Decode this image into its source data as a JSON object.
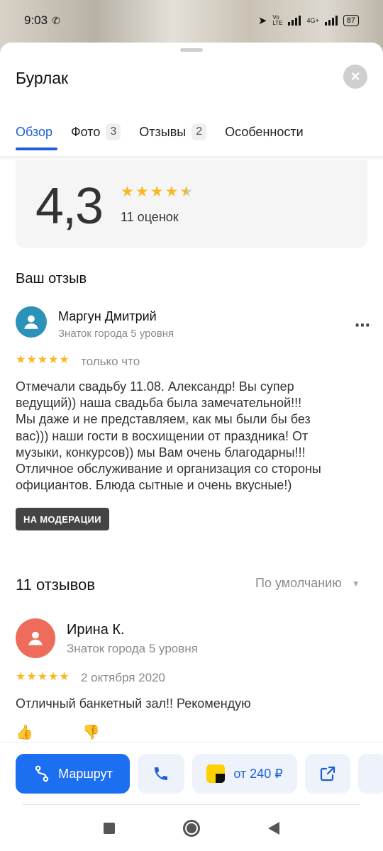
{
  "status": {
    "time": "9:03",
    "battery": "87",
    "network": "4G+"
  },
  "header": {
    "title": "Бурлак"
  },
  "tabs": [
    {
      "label": "Обзор"
    },
    {
      "label": "Фото",
      "count": "3"
    },
    {
      "label": "Отзывы",
      "count": "2"
    },
    {
      "label": "Особенности"
    }
  ],
  "rating": {
    "value": "4,3",
    "stars": 4.5,
    "count_label": "11 оценок"
  },
  "your_review": {
    "heading": "Ваш отзыв",
    "author": "Маргун Дмитрий",
    "level": "Знаток города 5 уровня",
    "stars": 5,
    "date": "только что",
    "text_lines": [
      "Отмечали свадьбу 11.08. Александр! Вы супер",
      "ведущий)) наша свадьба была замечательной!!!",
      "Мы даже и не представляем, как мы были бы без",
      "вас))) наши гости в восхищении от праздника! От",
      "музыки, конкурсов)) мы Вам очень благодарны!!!",
      "Отличное обслуживание и организация со стороны",
      "официантов. Блюда сытные и очень вкусные!)"
    ],
    "badge": "НА МОДЕРАЦИИ",
    "avatar_color": "#2b93b8"
  },
  "reviews": {
    "heading": "11 отзывов",
    "sort_label": "По умолчанию",
    "items": [
      {
        "author": "Ирина К.",
        "level": "Знаток города 5 уровня",
        "stars": 5,
        "date": "2 октября 2020",
        "text": "Отличный банкетный зал!! Рекомендую",
        "avatar_color": "#ee6c5b"
      }
    ]
  },
  "actions": {
    "route_label": "Маршрут",
    "taxi_label": "от 240 ₽"
  },
  "colors": {
    "accent": "#1d6ff2",
    "star": "#f8b826"
  }
}
